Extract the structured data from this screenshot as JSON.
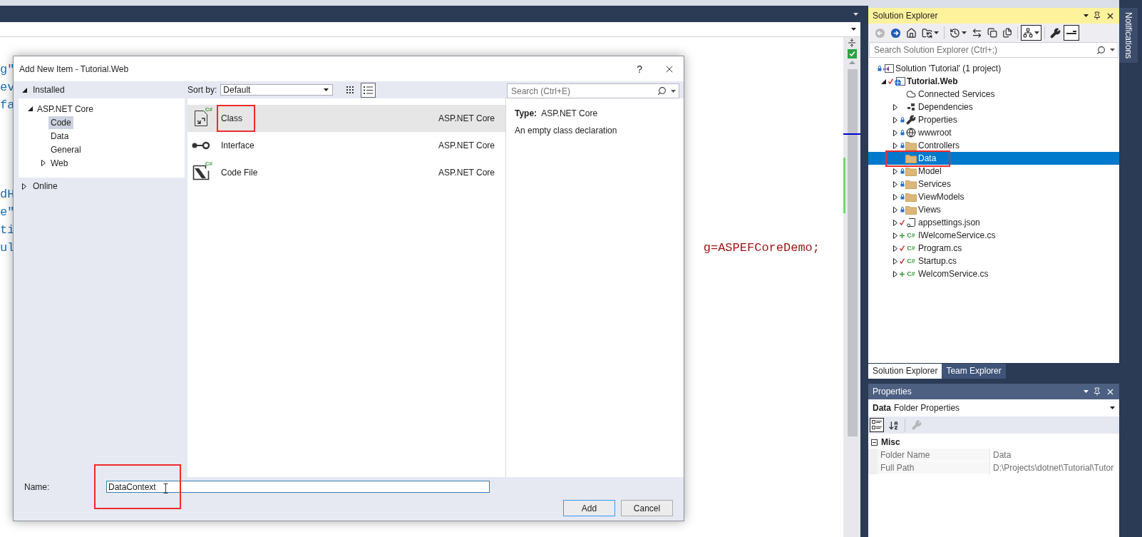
{
  "editor": {
    "code_blocks": [
      {
        "lines": [
          {
            "text": "g\""
          },
          {
            "text": "ev"
          },
          {
            "text": "fa"
          }
        ]
      },
      {
        "lines": [
          {
            "text": "dH"
          },
          {
            "text": "e\""
          },
          {
            "text": "ti"
          },
          {
            "text": "ul",
            "tail": "g=ASPEFCoreDemo;"
          }
        ]
      }
    ]
  },
  "dialog": {
    "title": "Add New Item - Tutorial.Web",
    "help": "?",
    "categories": [
      {
        "label": "Installed",
        "expanded": true,
        "children": [
          {
            "label": "ASP.NET Core",
            "expanded": true,
            "selected": false,
            "children": [
              {
                "label": "Code",
                "selected": true
              },
              {
                "label": "Data",
                "selected": false
              },
              {
                "label": "General",
                "selected": false
              },
              {
                "label": "Web",
                "expanded": false,
                "selected": false
              }
            ]
          }
        ]
      },
      {
        "label": "Online",
        "expanded": false
      }
    ],
    "sort_by": {
      "label": "Sort by:",
      "value": "Default"
    },
    "view_buttons": [
      {
        "kind": "grid",
        "selected": false
      },
      {
        "kind": "list",
        "selected": true
      }
    ],
    "search": {
      "placeholder": "Search (Ctrl+E)"
    },
    "templates": [
      {
        "kind": "class",
        "icon_label": "C#",
        "name": "Class",
        "group": "ASP.NET Core",
        "selected": true,
        "highlighted": true
      },
      {
        "kind": "interface",
        "name": "Interface",
        "group": "ASP.NET Core",
        "selected": false,
        "highlighted": false
      },
      {
        "kind": "codefile",
        "icon_label": "C#",
        "name": "Code File",
        "group": "ASP.NET Core",
        "selected": false,
        "highlighted": false
      }
    ],
    "details": {
      "type_label": "Type:",
      "type_value": "ASP.NET Core",
      "description": "An empty class declaration"
    },
    "name_field": {
      "label": "Name:",
      "value": "DataContext",
      "highlighted": true
    },
    "buttons": [
      {
        "label": "Add",
        "kind": "default"
      },
      {
        "label": "Cancel",
        "kind": "normal"
      }
    ]
  },
  "solution_explorer": {
    "title": "Solution Explorer",
    "toolbar": [
      {
        "kind": "back",
        "disabled": true,
        "pressed": false,
        "dropdown": false
      },
      {
        "kind": "forward",
        "disabled": false,
        "pressed": false,
        "dropdown": false
      },
      {
        "kind": "home",
        "disabled": false,
        "pressed": false,
        "dropdown": false
      },
      {
        "kind": "sync",
        "disabled": false,
        "pressed": false,
        "dropdown": true
      },
      {
        "kind": "separator"
      },
      {
        "kind": "history",
        "disabled": false,
        "pressed": false,
        "dropdown": true
      },
      {
        "kind": "swap",
        "disabled": false,
        "pressed": false,
        "dropdown": false
      },
      {
        "kind": "collapse",
        "disabled": false,
        "pressed": false,
        "dropdown": false
      },
      {
        "kind": "copy",
        "disabled": false,
        "pressed": false,
        "dropdown": false
      },
      {
        "kind": "separator"
      },
      {
        "kind": "show-all",
        "disabled": false,
        "pressed": true,
        "dropdown": true
      },
      {
        "kind": "separator"
      },
      {
        "kind": "wrench",
        "disabled": false,
        "pressed": false,
        "dropdown": false
      },
      {
        "kind": "preview",
        "disabled": false,
        "pressed": true,
        "dropdown": false
      }
    ],
    "search": {
      "placeholder": "Search Solution Explorer (Ctrl+;)"
    },
    "tree": [
      {
        "label": "Solution 'Tutorial' (1 project)",
        "kind": "solution",
        "locked": true,
        "selected": false,
        "children": [
          {
            "label": "Tutorial.Web",
            "kind": "project",
            "modified": true,
            "expanded": true,
            "bold": true,
            "selected": false,
            "children": [
              {
                "label": "Connected Services",
                "kind": "cloud",
                "selected": false
              },
              {
                "label": "Dependencies",
                "kind": "dependencies",
                "expanded": false,
                "selected": false
              },
              {
                "label": "Properties",
                "kind": "wrench",
                "locked": true,
                "expanded": false,
                "selected": false
              },
              {
                "label": "wwwroot",
                "kind": "globe",
                "locked": true,
                "expanded": false,
                "selected": false
              },
              {
                "label": "Controllers",
                "kind": "folder",
                "locked": true,
                "expanded": false,
                "selected": false
              },
              {
                "label": "Data",
                "kind": "folder",
                "selected": true,
                "highlighted": true
              },
              {
                "label": "Model",
                "kind": "folder",
                "locked": true,
                "expanded": false,
                "selected": false
              },
              {
                "label": "Services",
                "kind": "folder",
                "locked": true,
                "expanded": false,
                "selected": false
              },
              {
                "label": "ViewModels",
                "kind": "folder",
                "locked": true,
                "expanded": false,
                "selected": false
              },
              {
                "label": "Views",
                "kind": "folder",
                "locked": true,
                "expanded": false,
                "selected": false
              },
              {
                "label": "appsettings.json",
                "kind": "json",
                "modified": true,
                "expanded": false,
                "selected": false
              },
              {
                "label": "IWelcomeService.cs",
                "kind": "csharp",
                "icon_label": "C#",
                "added": true,
                "expanded": false,
                "selected": false
              },
              {
                "label": "Program.cs",
                "kind": "csharp",
                "icon_label": "C#",
                "modified": true,
                "expanded": false,
                "selected": false
              },
              {
                "label": "Startup.cs",
                "kind": "csharp",
                "icon_label": "C#",
                "modified": true,
                "expanded": false,
                "selected": false
              },
              {
                "label": "WelcomService.cs",
                "kind": "csharp",
                "icon_label": "C#",
                "added": true,
                "expanded": false,
                "selected": false
              }
            ]
          }
        ]
      }
    ],
    "tabs": [
      {
        "label": "Solution Explorer",
        "selected": true
      },
      {
        "label": "Team Explorer",
        "selected": false
      }
    ]
  },
  "properties": {
    "title": "Properties",
    "object_name": "Data",
    "object_type": "Folder Properties",
    "toolbar": [
      {
        "kind": "categorized",
        "selected": true,
        "disabled": false
      },
      {
        "kind": "alphabetical",
        "selected": false,
        "disabled": false
      },
      {
        "kind": "separator"
      },
      {
        "kind": "property-pages",
        "selected": false,
        "disabled": true
      }
    ],
    "categories": [
      {
        "label": "Misc",
        "expanded": true,
        "rows": [
          {
            "name": "Folder Name",
            "value": "Data"
          },
          {
            "name": "Full Path",
            "value": "D:\\Projects\\dotnet\\Tutorial\\Tutor"
          }
        ]
      }
    ]
  },
  "notifications": {
    "label": "Notifications"
  }
}
